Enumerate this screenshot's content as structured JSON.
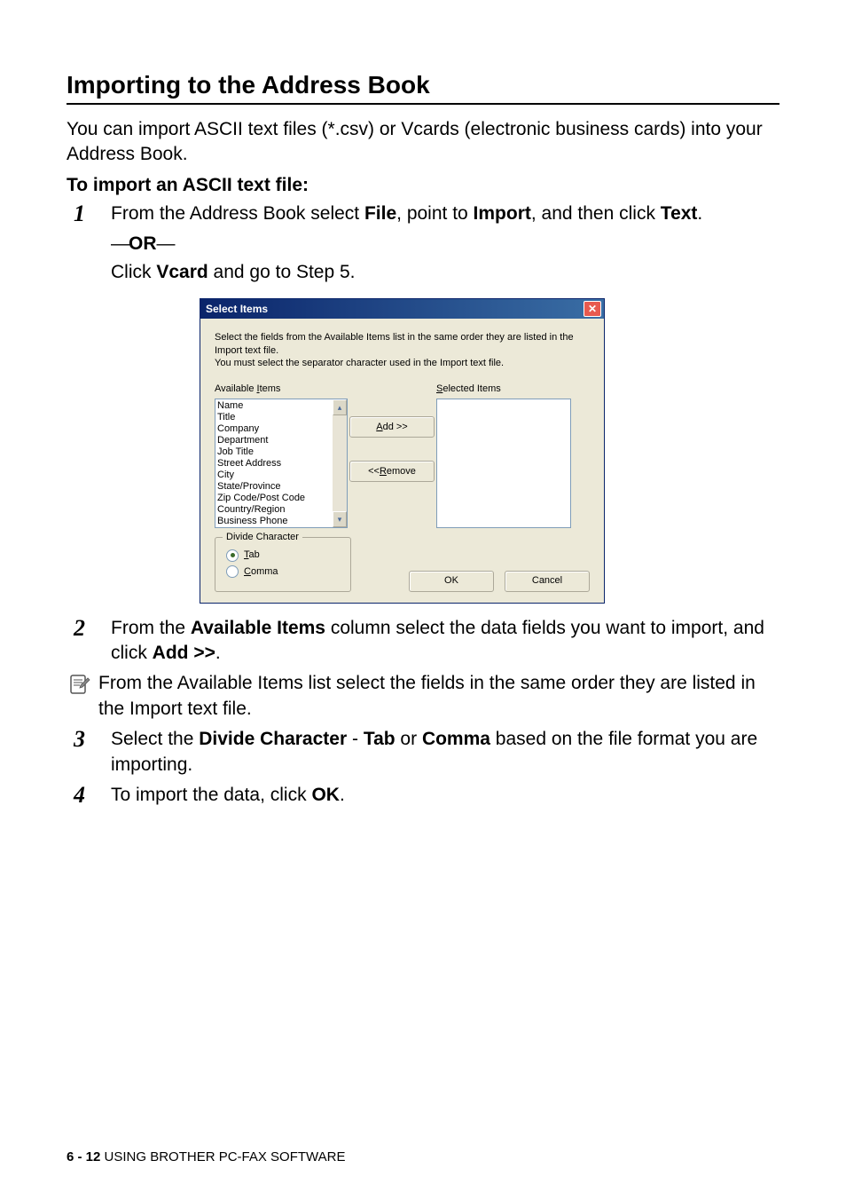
{
  "title": "Importing to the Address Book",
  "intro": "You can import ASCII text files (*.csv) or Vcards (electronic business cards) into your Address Book.",
  "subhead": "To import an ASCII text file:",
  "steps": {
    "s1_a": "From the Address Book select ",
    "s1_b": "File",
    "s1_c": ", point to ",
    "s1_d": "Import",
    "s1_e": ", and then click ",
    "s1_f": "Text",
    "s1_g": ".",
    "or": "OR",
    "s1_h": "Click ",
    "s1_i": "Vcard",
    "s1_j": " and go to Step 5.",
    "s2_a": "From the ",
    "s2_b": "Available Items",
    "s2_c": " column select the data fields you want to import, and click ",
    "s2_d": "Add >>",
    "s2_e": ".",
    "note": "From the Available Items list select the fields in the same order they are listed in the Import text file.",
    "s3_a": "Select the ",
    "s3_b": "Divide Character",
    "s3_c": " - ",
    "s3_d": "Tab",
    "s3_e": " or ",
    "s3_f": "Comma",
    "s3_g": " based on the file format you are importing.",
    "s4_a": "To import the data, click ",
    "s4_b": "OK",
    "s4_c": "."
  },
  "dialog": {
    "title": "Select Items",
    "instruction1": "Select the fields from the Available Items list in the same order they are listed in the Import text file.",
    "instruction2": "You must select the separator character used in the Import text file.",
    "available_label_pre": "Available ",
    "available_label_u": "I",
    "available_label_post": "tems",
    "selected_label_u": "S",
    "selected_label_post": "elected Items",
    "available_items": [
      "Name",
      "Title",
      "Company",
      "Department",
      "Job Title",
      "Street Address",
      "City",
      "State/Province",
      "Zip Code/Post Code",
      "Country/Region",
      "Business Phone"
    ],
    "add_u": "A",
    "add_post": "dd >>",
    "remove_pre": "<< ",
    "remove_u": "R",
    "remove_post": "emove",
    "divide_label": "Divide Character",
    "tab_u": "T",
    "tab_post": "ab",
    "comma_u": "C",
    "comma_post": "omma",
    "ok": "OK",
    "cancel": "Cancel"
  },
  "footer": {
    "page": "6 - 12",
    "label": "   USING BROTHER PC-FAX SOFTWARE"
  }
}
